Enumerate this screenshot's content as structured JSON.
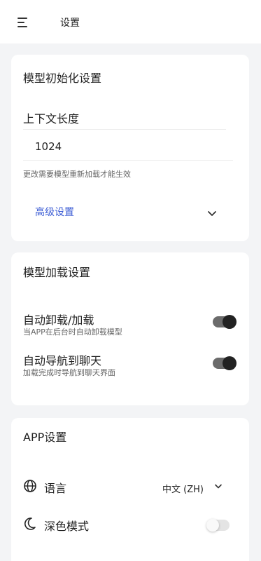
{
  "header": {
    "title": "设置",
    "menu_icon": "menu-icon"
  },
  "model_init": {
    "title": "模型初始化设置",
    "context_length_label": "上下文长度",
    "context_length_value": "1024",
    "context_hint": "更改需要模型重新加载才能生效",
    "advanced_label": "高级设置"
  },
  "model_load": {
    "title": "模型加载设置",
    "auto_unload_label": "自动卸载/加载",
    "auto_unload_desc": "当APP在后台时自动卸载模型",
    "auto_unload_on": true,
    "auto_nav_label": "自动导航到聊天",
    "auto_nav_desc": "加载完成时导航到聊天界面",
    "auto_nav_on": true
  },
  "app": {
    "title": "APP设置",
    "language_label": "语言",
    "language_value": "中文 (ZH)",
    "dark_mode_label": "深色模式",
    "dark_mode_on": false
  },
  "colors": {
    "accent_link": "#3a5bd4",
    "toggle_on_knob": "#222222",
    "background": "#f3f4f6"
  }
}
